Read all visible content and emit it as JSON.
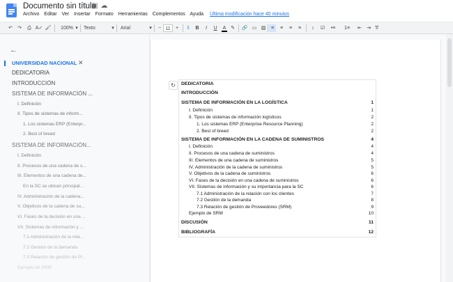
{
  "app": {
    "doc_title": "Documento sin título",
    "menus": [
      "Archivo",
      "Editar",
      "Ver",
      "Insertar",
      "Formato",
      "Herramientas",
      "Complementos",
      "Ayuda"
    ],
    "last_edit": "Última modificación hace 40 minutos",
    "star_glyph": "☆",
    "move_glyph": "▣",
    "cloud_glyph": "☁"
  },
  "toolbar": {
    "undo": "↶",
    "redo": "↷",
    "print": "⎙",
    "spell": "A✓",
    "paint": "🖌",
    "zoom": "100%",
    "style": "Texto norm...",
    "font": "Arial",
    "size_minus": "−",
    "font_size": "11",
    "size_plus": "+",
    "bold": "B",
    "italic": "I",
    "underline": "U",
    "text_color": "A",
    "highlight": "✎",
    "link": "🔗",
    "comment": "▭",
    "image": "▨",
    "align_left": "≡",
    "align_center": "≡",
    "align_right": "≡",
    "justify": "≡",
    "line_spacing": "↕",
    "checklist": "☑",
    "bullets": "•≡",
    "numbered": "1≡",
    "indent_less": "⇤",
    "indent_more": "⇥",
    "clear_format": "T̸"
  },
  "sidebar": {
    "back_glyph": "←",
    "title": "UNIVERSIDAD NACIONAL",
    "close_glyph": "✕",
    "items": [
      {
        "label": "DEDICATORIA"
      },
      {
        "label": "INTRODUCCIÓN"
      },
      {
        "label": "SISTEMA DE INFORMACIÓN ..."
      },
      {
        "label": "I. Definición"
      },
      {
        "label": "II. Tipos de sistemas de inform..."
      },
      {
        "label": "1. Los sistemas ERP (Enterpr..."
      },
      {
        "label": "2. Best of breed"
      },
      {
        "label": "SISTEMA DE INFORMACIÓN..."
      },
      {
        "label": "I. Definición"
      },
      {
        "label": "II. Procesos de una cadena de s..."
      },
      {
        "label": "III. Elementos de una cadena de..."
      },
      {
        "label": "En la SC se ubican principal..."
      },
      {
        "label": "IV. Administración de la cadena..."
      },
      {
        "label": "V. Objetivos de la cadena de su..."
      },
      {
        "label": "VI. Fases de la decisión en una ..."
      },
      {
        "label": "VII. Sistemas de información y ..."
      },
      {
        "label": "7.1 Administración de la rela..."
      },
      {
        "label": "7.2 Gestión de la demanda"
      },
      {
        "label": "7.3 Relación de gestión de Pr..."
      },
      {
        "label": "Ejemplo de SRM"
      }
    ]
  },
  "document": {
    "refresh_glyph": "↻",
    "toc": [
      {
        "text": "DEDICATORIA",
        "page": ""
      },
      {
        "text": "INTRODUCCIÓN",
        "page": ""
      },
      {
        "text": "SISTEMA DE INFORMACIÓN EN LA LOGÍSTICA",
        "page": "1"
      },
      {
        "text": "I.    Definición",
        "page": "1"
      },
      {
        "text": "II.    Tipos de sistemas de información logísticos",
        "page": "2"
      },
      {
        "text": "1.   Los sistemas ERP (Enterprise Resource Planning)",
        "page": "2"
      },
      {
        "text": "2.   Best of breed",
        "page": "2"
      },
      {
        "text": "SISTEMA DE INFORMACIÓN EN LA CADENA DE SUMINISTROS",
        "page": "4"
      },
      {
        "text": "I.    Definición",
        "page": "4"
      },
      {
        "text": "II.    Procesos de una cadena de suministros",
        "page": "4"
      },
      {
        "text": "III.    Elementos de una cadena de suministros",
        "page": "5"
      },
      {
        "text": "IV.    Administración de la cadena de suministros",
        "page": "5"
      },
      {
        "text": "V.    Objetivos de la cadena de suministros",
        "page": "6"
      },
      {
        "text": "VI.    Fases de la decisión en una cadena de suministros",
        "page": "6"
      },
      {
        "text": "VII.    Sistemas de información y su importancia para la SC",
        "page": "6"
      },
      {
        "text": "7.1  Administración de la relación con los clientes",
        "page": "7"
      },
      {
        "text": "7.2  Gestión de la demanda",
        "page": "8"
      },
      {
        "text": "7.3  Relación de gestión de Proveedores (SRM)",
        "page": "9"
      },
      {
        "text": "Ejemplo de SRM",
        "page": "10"
      },
      {
        "text": "DISCUSIÓN",
        "page": "11"
      },
      {
        "text": "BIBLIOGRAFÍA",
        "page": "12"
      }
    ]
  }
}
